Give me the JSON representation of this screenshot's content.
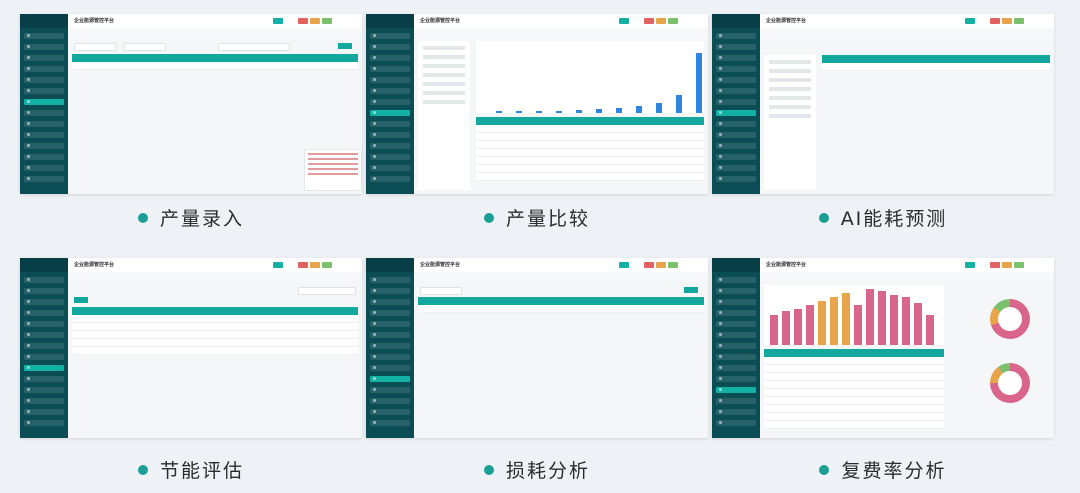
{
  "app": {
    "title": "企业能源管控平台"
  },
  "panels": [
    {
      "id": "production-entry",
      "caption": "产量录入"
    },
    {
      "id": "production-compare",
      "caption": "产量比较"
    },
    {
      "id": "ai-energy-forecast",
      "caption": "AI能耗预测"
    },
    {
      "id": "energy-saving-eval",
      "caption": "节能评估"
    },
    {
      "id": "loss-analysis",
      "caption": "损耗分析"
    },
    {
      "id": "tariff-rate-analysis",
      "caption": "复费率分析"
    }
  ],
  "colors": {
    "accent": "#1a9f95",
    "sidebar": "#0a4d55",
    "bar_pink": "#d9668a",
    "bar_orange": "#e8a44a",
    "bar_blue": "#2f86e0"
  }
}
